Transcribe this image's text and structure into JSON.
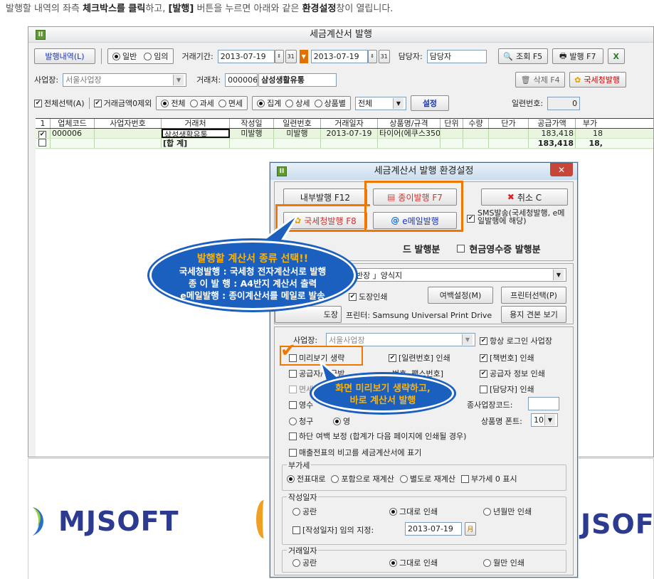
{
  "caption": {
    "p1": "발행할 내역의 좌측 ",
    "b1": "체크박스를 클릭",
    "p2": "하고, ",
    "b2": "[발행]",
    "p3": " 버튼을 누르면 아래와 같은 ",
    "b3": "환경설정",
    "p4": "창이 열립니다."
  },
  "main_window": {
    "title": "세금계산서 발행",
    "app_icon": "II",
    "toolbar1": {
      "history_button": "발행내역(L)",
      "radio_general": "일반",
      "radio_optional": "임의",
      "period_label": "거래기간:",
      "date_from": "2013-07-19",
      "date_to": "2013-07-19",
      "manager_label": "담당자:",
      "manager_value": "담당자",
      "search_button": "조회 F5",
      "issue_button": "발행 F7"
    },
    "toolbar2": {
      "business_label": "사업장:",
      "business_value": "서울사업장",
      "partner_label": "거래처:",
      "partner_code": "000006",
      "partner_name": "삼성생활유통",
      "delete_button": "삭제 F4",
      "nts_button": "국세청발행"
    },
    "toolbar3": {
      "select_all": "전체선택(A)",
      "exclude_zero": "거래금액0제외",
      "tax_all": "전체",
      "tax_taxable": "과세",
      "tax_exempt": "면세",
      "group_sum": "집계",
      "group_detail": "상세",
      "group_item": "상품별",
      "filter_value": "전체",
      "settings_button": "설정",
      "serial_label": "일련번호:",
      "serial_value": "0"
    },
    "grid": {
      "headers": [
        "1",
        "업체코드",
        "사업자번호",
        "거래처",
        "작성일",
        "일련번호",
        "거래일자",
        "상품명/규격",
        "단위",
        "수량",
        "단가",
        "공급가액",
        "부가"
      ],
      "row1": [
        "000006",
        "",
        "삼성생활유통",
        "미발행",
        "미발행",
        "2013-07-19",
        "타이어(에쿠스350)",
        "",
        "",
        "",
        "183,418",
        "18"
      ],
      "total_label": "[합 계]",
      "total_supply": "183,418",
      "total_vat": "18,"
    }
  },
  "dialog": {
    "title": "세금계산서 발행 환경설정",
    "app_icon": "II",
    "close": "✕",
    "btn_internal": "내부발행 F12",
    "btn_paper": "종이발행 F7",
    "btn_cancel": "취소 C",
    "btn_nts": "국세청발행 F8",
    "btn_email": "e메일발행",
    "sms_label": "SMS발송(국세청발행, e메일발행에 해당)",
    "card_label": "드 발행분",
    "cash_receipt_label": "현금영수증 발행분",
    "form_select": "반장 」양식지",
    "stamp_label": "도장인쇄",
    "margin_button": "여백설정(M)",
    "printer_select_button": "프린터선택(P)",
    "stamp_button_partial": "도장",
    "printer_label": "프린터: Samsung Universal Print Drive",
    "sample_button": "용지 견본 보기",
    "business_label": "사업장:",
    "business_value": "서울사업장",
    "always_login": "항상 로그인 사업장",
    "skip_preview": "미리보기 생략",
    "serial_print": "[일련번호] 인쇄",
    "book_number_print": "[책번호] 인쇄",
    "supplier_partial": "공급자/공급받",
    "fax_partial": "번호, 팩스번호]",
    "supplier_info": "공급자 정보 인쇄",
    "exempt_partial": "면세",
    "manager_print": "[담당자] 인쇄",
    "receipt_partial": "영수",
    "sub_business_code": "종사업장코드:",
    "claim_label": "청구",
    "receipt_label2": "영",
    "font_label": "상품명 폰트:",
    "font_value": "10",
    "bottom_margin": "하단 여백 보정 (합계가 다음 페이지에 인쇄될 경우)",
    "remark_label": "매출전표의 비고를 세금계산서에 표기",
    "vat_group": "부가세",
    "vat_opt1": "전표대로",
    "vat_opt2": "포함으로 재계산",
    "vat_opt3": "별도로 재계산",
    "vat_zero": "부가세 0 표시",
    "write_group": "작성일자",
    "write_opt1": "공란",
    "write_opt2": "그대로 인쇄",
    "write_opt3": "년월만 인쇄",
    "write_custom": "[작성일자] 임의 지정:",
    "write_date": "2013-07-19",
    "trade_group": "거래일자",
    "trade_opt1": "공란",
    "trade_opt2": "그대로 인쇄",
    "trade_opt3": "월만 인쇄"
  },
  "callout1": {
    "title": "발행할 계산서 종류 선택!!",
    "line1": "국세청발행 : 국세청 전자계산서로 발행",
    "line2": "종 이 발 행 : A4반지 계산서 출력",
    "line3": "e메일발행 : 종이계산서를 메일로 발송"
  },
  "callout2": {
    "line1": "화면 미리보기 생략하고,",
    "line2": "바로 계산서 발행"
  },
  "logos": {
    "left": "MJSOFT",
    "right": "JSOF"
  },
  "colors": {
    "orange": "#f07800",
    "callout_blue": "#1b5fbf",
    "grid_green": "#e9f5df",
    "logo_navy": "#2c3b8f"
  }
}
